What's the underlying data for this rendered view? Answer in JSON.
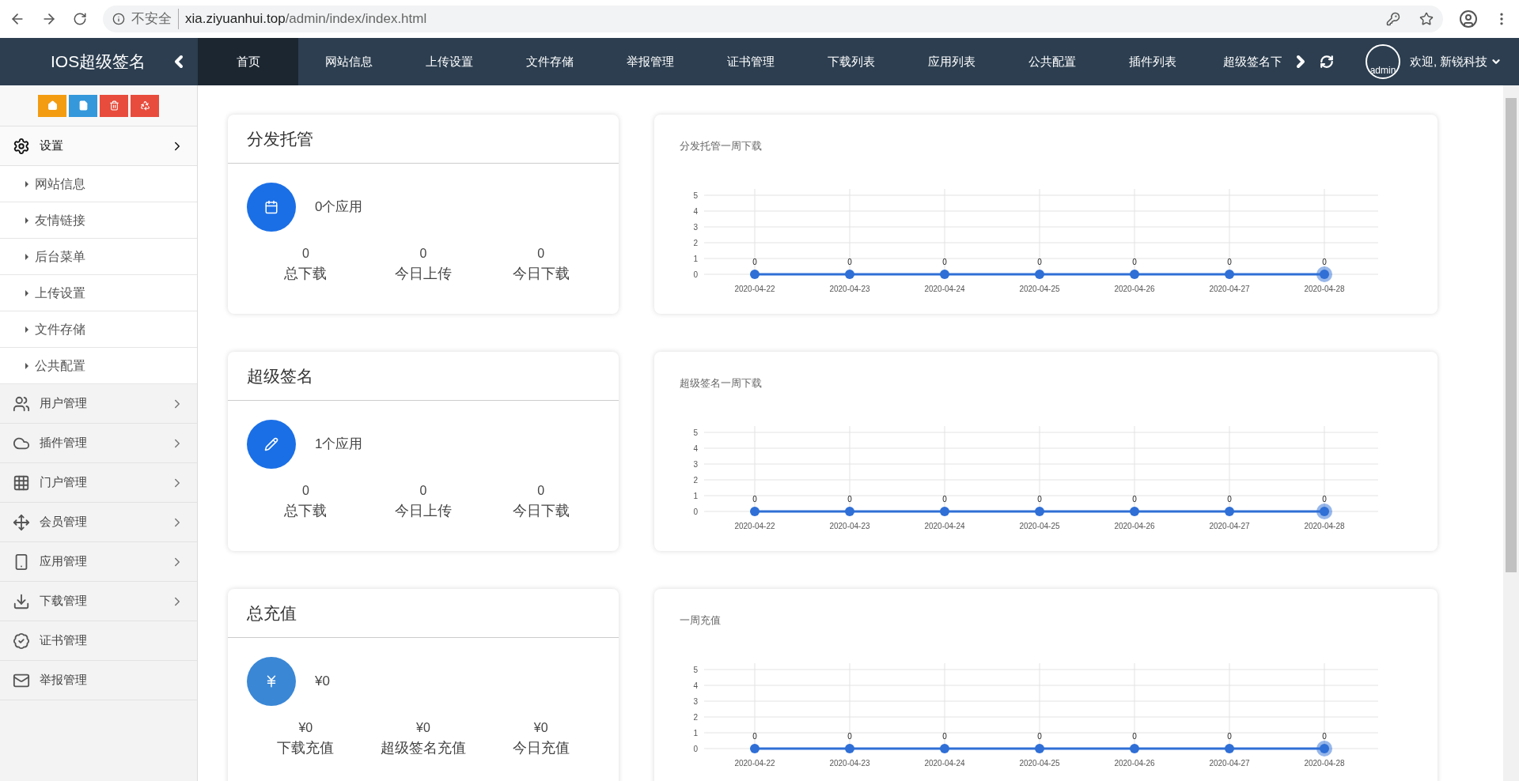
{
  "browser": {
    "security": "不安全",
    "url_host": "xia.ziyuanhui.top",
    "url_path": "/admin/index/index.html"
  },
  "brand": "IOS超级签名",
  "nav": [
    {
      "label": "首页",
      "selected": true
    },
    {
      "label": "网站信息",
      "selected": false
    },
    {
      "label": "上传设置",
      "selected": false
    },
    {
      "label": "文件存储",
      "selected": false
    },
    {
      "label": "举报管理",
      "selected": false
    },
    {
      "label": "证书管理",
      "selected": false
    },
    {
      "label": "下载列表",
      "selected": false
    },
    {
      "label": "应用列表",
      "selected": false
    },
    {
      "label": "公共配置",
      "selected": false
    },
    {
      "label": "插件列表",
      "selected": false
    },
    {
      "label": "超级签名下",
      "selected": false
    }
  ],
  "user": {
    "avatar_alt": "admin",
    "greeting": "欢迎, 新锐科技"
  },
  "sidebar": {
    "items": [
      {
        "label": "设置",
        "expanded": true,
        "kind": "group",
        "children": [
          {
            "label": "网站信息"
          },
          {
            "label": "友情链接"
          },
          {
            "label": "后台菜单"
          },
          {
            "label": "上传设置"
          },
          {
            "label": "文件存储"
          },
          {
            "label": "公共配置"
          }
        ]
      },
      {
        "label": "用户管理",
        "expanded": false,
        "kind": "group"
      },
      {
        "label": "插件管理",
        "expanded": false,
        "kind": "group"
      },
      {
        "label": "门户管理",
        "expanded": false,
        "kind": "group"
      },
      {
        "label": "会员管理",
        "expanded": false,
        "kind": "group"
      },
      {
        "label": "应用管理",
        "expanded": false,
        "kind": "group"
      },
      {
        "label": "下载管理",
        "expanded": false,
        "kind": "group"
      },
      {
        "label": "证书管理",
        "kind": "link"
      },
      {
        "label": "举报管理",
        "kind": "link"
      }
    ]
  },
  "panels": [
    {
      "title": "分发托管",
      "summary": "0个应用",
      "color": "#1a6fe6",
      "stats": [
        {
          "value": "0",
          "label": "总下载"
        },
        {
          "value": "0",
          "label": "今日上传"
        },
        {
          "value": "0",
          "label": "今日下载"
        }
      ],
      "chart_data": {
        "type": "line",
        "title": "分发托管一周下载",
        "categories": [
          "2020-04-22",
          "2020-04-23",
          "2020-04-24",
          "2020-04-25",
          "2020-04-26",
          "2020-04-27",
          "2020-04-28"
        ],
        "series": [
          {
            "color": "#2f6fd6",
            "marker": "circle",
            "values": [
              0,
              0,
              0,
              0,
              0,
              0,
              0
            ]
          }
        ],
        "ylim": [
          0,
          5
        ],
        "yticks": [
          0,
          1,
          2,
          3,
          4,
          5
        ],
        "grid": true,
        "data_labels": true
      }
    },
    {
      "title": "超级签名",
      "summary": "1个应用",
      "color": "#1a6fe6",
      "stats": [
        {
          "value": "0",
          "label": "总下载"
        },
        {
          "value": "0",
          "label": "今日上传"
        },
        {
          "value": "0",
          "label": "今日下载"
        }
      ],
      "chart_data": {
        "type": "line",
        "title": "超级签名一周下载",
        "categories": [
          "2020-04-22",
          "2020-04-23",
          "2020-04-24",
          "2020-04-25",
          "2020-04-26",
          "2020-04-27",
          "2020-04-28"
        ],
        "series": [
          {
            "color": "#2f6fd6",
            "marker": "circle",
            "values": [
              0,
              0,
              0,
              0,
              0,
              0,
              0
            ]
          }
        ],
        "ylim": [
          0,
          5
        ],
        "yticks": [
          0,
          1,
          2,
          3,
          4,
          5
        ],
        "grid": true,
        "data_labels": true
      }
    },
    {
      "title": "总充值",
      "summary": "¥0",
      "color": "#3a87d6",
      "stats": [
        {
          "value": "¥0",
          "label": "下载充值"
        },
        {
          "value": "¥0",
          "label": "超级签名充值"
        },
        {
          "value": "¥0",
          "label": "今日充值"
        }
      ],
      "chart_data": {
        "type": "line",
        "title": "一周充值",
        "categories": [
          "2020-04-22",
          "2020-04-23",
          "2020-04-24",
          "2020-04-25",
          "2020-04-26",
          "2020-04-27",
          "2020-04-28"
        ],
        "series": [
          {
            "color": "#2f6fd6",
            "marker": "circle",
            "values": [
              0,
              0,
              0,
              0,
              0,
              0,
              0
            ]
          }
        ],
        "ylim": [
          0,
          5
        ],
        "yticks": [
          0,
          1,
          2,
          3,
          4,
          5
        ],
        "grid": true,
        "data_labels": true
      }
    }
  ]
}
